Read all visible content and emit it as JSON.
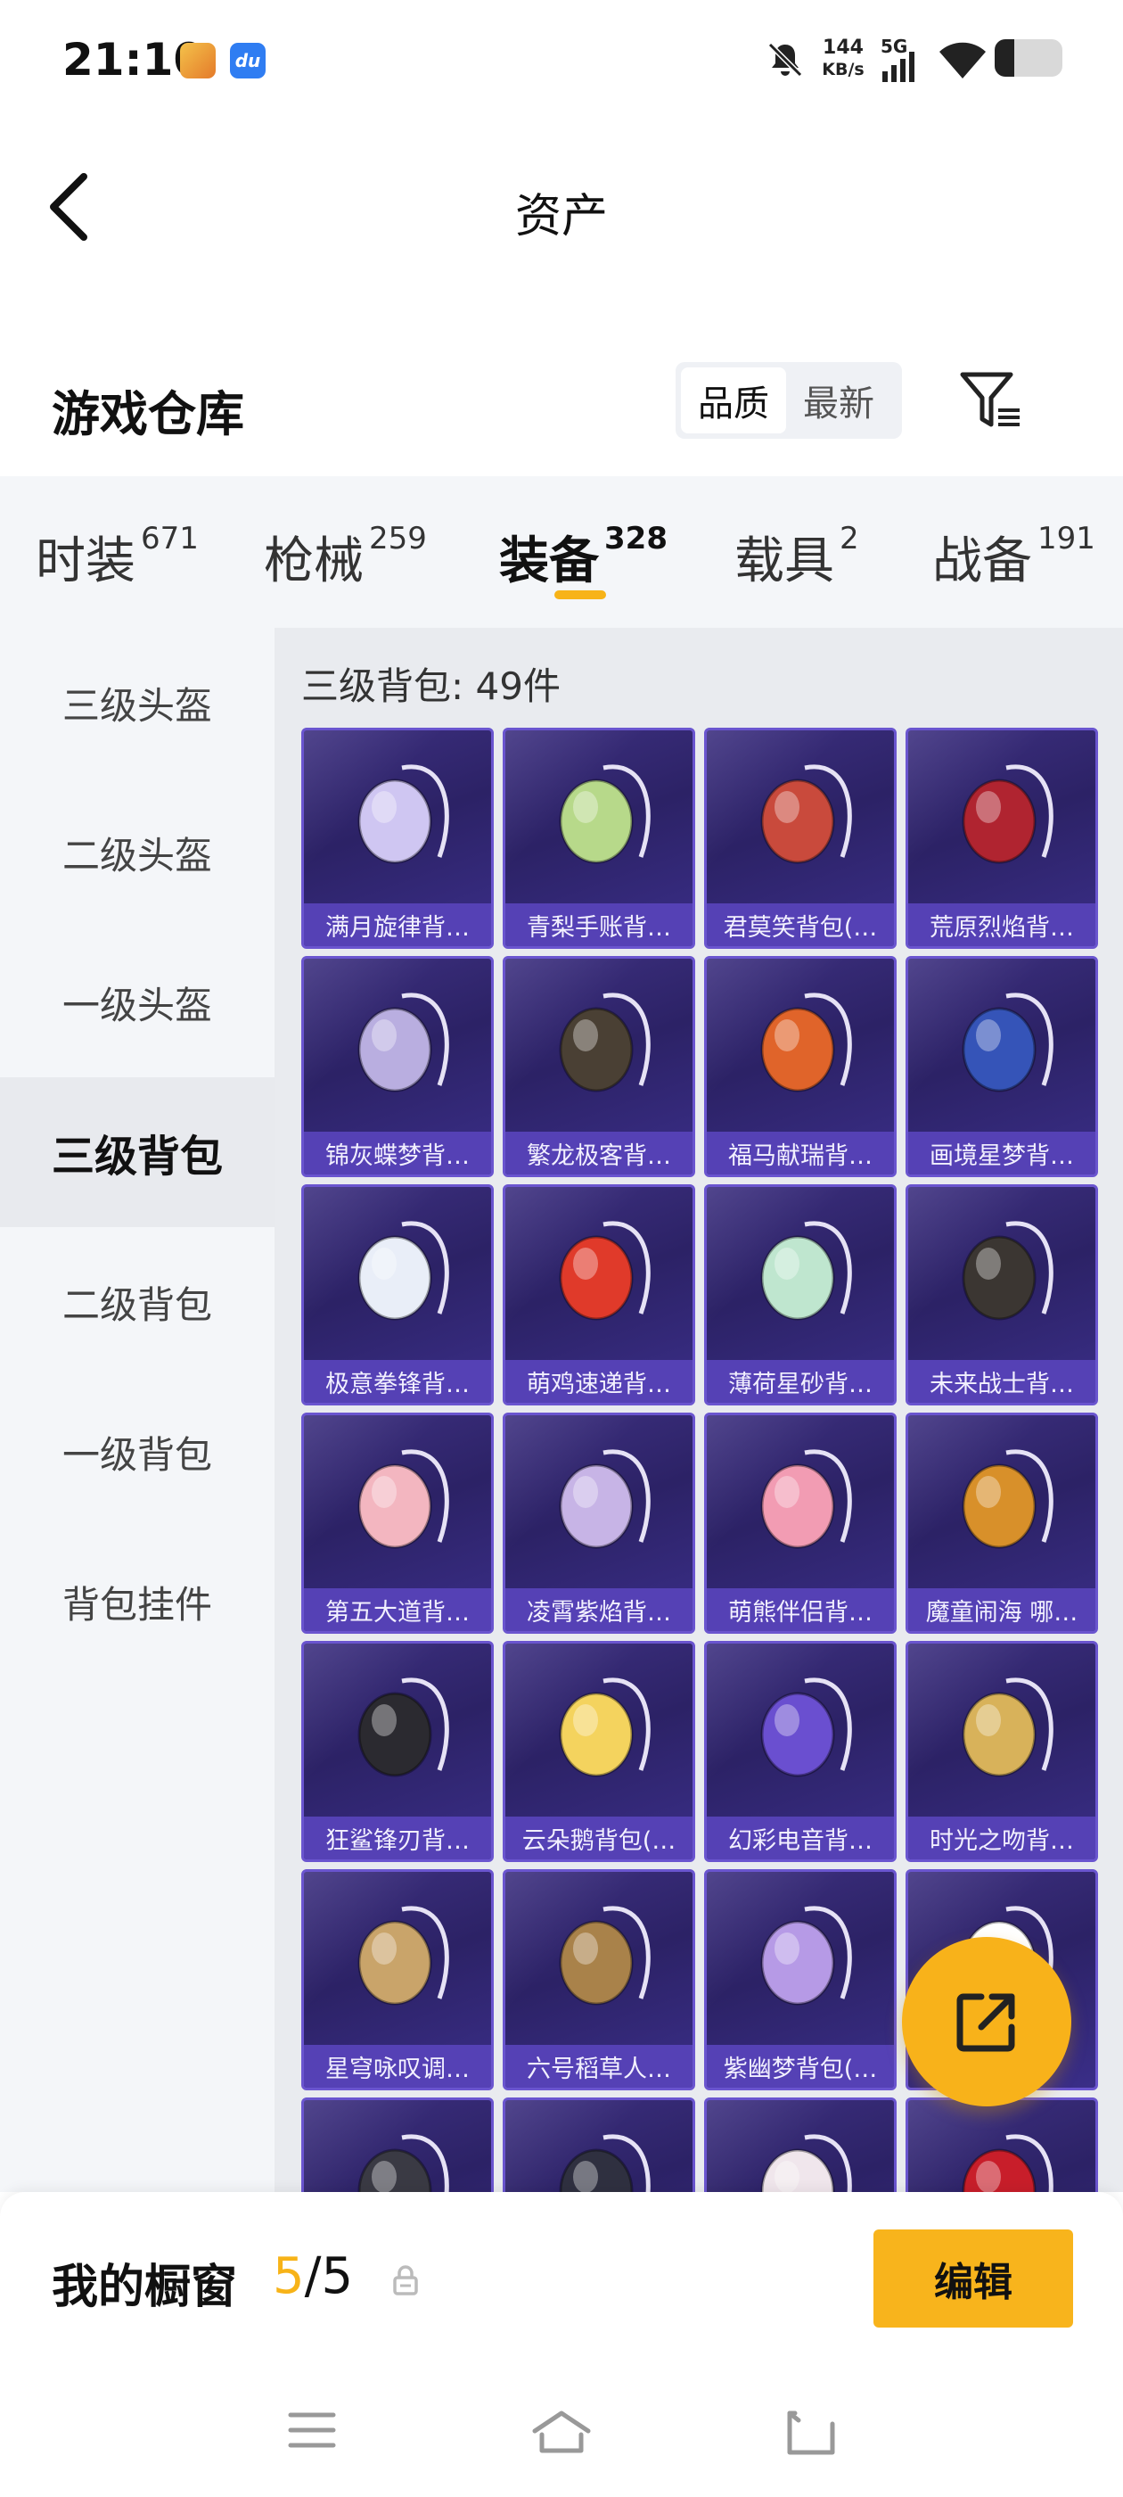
{
  "status_bar": {
    "time": "21:10",
    "net_speed_value": "144",
    "net_speed_unit": "KB/s",
    "network": "5G",
    "icons": [
      "game-app-icon",
      "baidu-app-icon",
      "mute-bell-icon",
      "signal-icon",
      "wifi-icon",
      "battery-icon"
    ]
  },
  "header": {
    "title": "资产"
  },
  "warehouse": {
    "title": "游戏仓库",
    "sort_options": [
      "品质",
      "最新"
    ],
    "sort_selected": "品质"
  },
  "tabs": [
    {
      "label": "时装",
      "count": "671"
    },
    {
      "label": "枪械",
      "count": "259"
    },
    {
      "label": "装备",
      "count": "328",
      "active": true
    },
    {
      "label": "载具",
      "count": "2"
    },
    {
      "label": "战备",
      "count": "191"
    }
  ],
  "sidebar": [
    {
      "label": "三级头盔"
    },
    {
      "label": "二级头盔"
    },
    {
      "label": "一级头盔"
    },
    {
      "label": "三级背包",
      "active": true
    },
    {
      "label": "二级背包"
    },
    {
      "label": "一级背包"
    },
    {
      "label": "背包挂件"
    }
  ],
  "content": {
    "section_title": "三级背包: 49件",
    "items": [
      {
        "name": "满月旋律背…",
        "color": "#cfc6f2"
      },
      {
        "name": "青梨手账背…",
        "color": "#b7d98a"
      },
      {
        "name": "君莫笑背包(…",
        "color": "#c94a3c"
      },
      {
        "name": "荒原烈焰背…",
        "color": "#b02430"
      },
      {
        "name": "锦灰蝶梦背…",
        "color": "#b9aee0"
      },
      {
        "name": "繁龙极客背…",
        "color": "#4a4034"
      },
      {
        "name": "福马献瑞背…",
        "color": "#e0642a"
      },
      {
        "name": "画境星梦背…",
        "color": "#3554b8"
      },
      {
        "name": "极意拳锋背…",
        "color": "#e9eef8"
      },
      {
        "name": "萌鸡速递背…",
        "color": "#e03a2a"
      },
      {
        "name": "薄荷星砂背…",
        "color": "#bfe6cf"
      },
      {
        "name": "未来战士背…",
        "color": "#3b3632"
      },
      {
        "name": "第五大道背…",
        "color": "#f3b6c0"
      },
      {
        "name": "凌霄紫焰背…",
        "color": "#c7b4e6"
      },
      {
        "name": "萌熊伴侣背…",
        "color": "#f29cb3"
      },
      {
        "name": "魔童闹海 哪…",
        "color": "#d8902a"
      },
      {
        "name": "狂鲨锋刃背…",
        "color": "#2b2a30"
      },
      {
        "name": "云朵鹅背包(…",
        "color": "#f4d35e"
      },
      {
        "name": "幻彩电音背…",
        "color": "#6a4fd0"
      },
      {
        "name": "时光之吻背…",
        "color": "#d8b25a"
      },
      {
        "name": "星穹咏叹调…",
        "color": "#c9a46a"
      },
      {
        "name": "六号稻草人…",
        "color": "#a9824a"
      },
      {
        "name": "紫幽梦背包(…",
        "color": "#b69ae6"
      },
      {
        "name": "",
        "color": "#ffffff"
      },
      {
        "name": "",
        "color": "#3a3a44"
      },
      {
        "name": "",
        "color": "#2f3040"
      },
      {
        "name": "",
        "color": "#f0e6ec"
      },
      {
        "name": "",
        "color": "#c81e2a"
      }
    ]
  },
  "showcase": {
    "label": "我的橱窗",
    "current": "5",
    "separator": "/",
    "total": "5",
    "edit_label": "编辑"
  },
  "nav": {
    "icons": [
      "menu-icon",
      "home-icon",
      "back-icon"
    ]
  },
  "colors": {
    "accent": "#f7b318",
    "card_bg": "#2c2266",
    "card_label_bg": "#5541b5"
  }
}
